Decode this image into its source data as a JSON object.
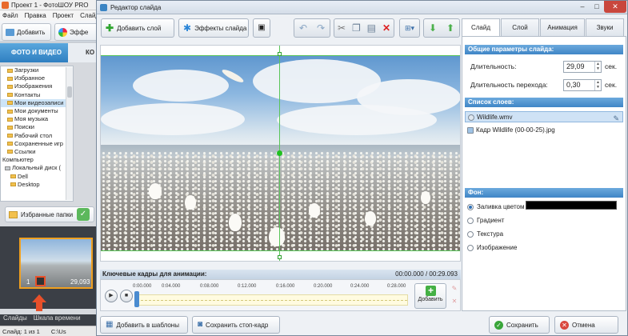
{
  "main": {
    "title": "Проект 1 - ФотоШОУ PRO",
    "menu": [
      "Файл",
      "Правка",
      "Проект",
      "Слайд"
    ],
    "toolbar": {
      "add_label": "Добавить",
      "effects_label": "Эффе"
    },
    "tabs": {
      "photo_video": "ФОТО И ВИДЕО",
      "second": "КО"
    },
    "tree": [
      "Загрузки",
      "Избранное",
      "Изображения",
      "Контакты",
      "Мои видеозаписи",
      "Мои документы",
      "Моя музыка",
      "Поиски",
      "Рабочий стол",
      "Сохраненные игр",
      "Ссылки",
      "Компьютер",
      "Локальный диск (",
      "Dell",
      "Desktop"
    ],
    "fav_folders_label": "Избранные папки",
    "slide": {
      "number": "1",
      "duration": "29,093"
    },
    "bottom_tabs": [
      "Слайды",
      "Шкала времени"
    ],
    "status": {
      "slide": "Слайд: 1 из 1",
      "path": "C:\\Us"
    }
  },
  "dialog": {
    "title": "Редактор слайда",
    "toolbar": {
      "add_layer": "Добавить слой",
      "slide_effects": "Эффекты слайда"
    },
    "keyframes": {
      "header": "Ключевые кадры для анимации:",
      "time": "00:00.000 / 00:29.093",
      "ruler": [
        "0:00.000",
        "0:04.000",
        "0:08.000",
        "0:12.000",
        "0:16.000",
        "0:20.000",
        "0:24.000",
        "0:28.000"
      ],
      "add_label": "Добавить",
      "playhead_position": 0
    },
    "bottom": {
      "add_templates": "Добавить в шаблоны",
      "save_stopframe": "Сохранить стоп-кадр",
      "save": "Сохранить",
      "cancel": "Отмена"
    },
    "right_panel": {
      "tabs": [
        "Слайд",
        "Слой",
        "Анимация",
        "Звуки"
      ],
      "active_tab": "Слайд",
      "general_header": "Общие параметры слайда:",
      "duration_label": "Длительность:",
      "duration_value": "29,09",
      "transition_label": "Длительность перехода:",
      "transition_value": "0,30",
      "unit": "сек.",
      "layers_header": "Список слоев:",
      "layers": [
        "Wildlife.wmv",
        "Кадр Wildlife (00-00-25).jpg"
      ],
      "background_header": "Фон:",
      "bg_options": [
        "Заливка цветом",
        "Градиент",
        "Текстура",
        "Изображение"
      ],
      "bg_selected": "Заливка цветом",
      "bg_color": "#000000"
    }
  }
}
